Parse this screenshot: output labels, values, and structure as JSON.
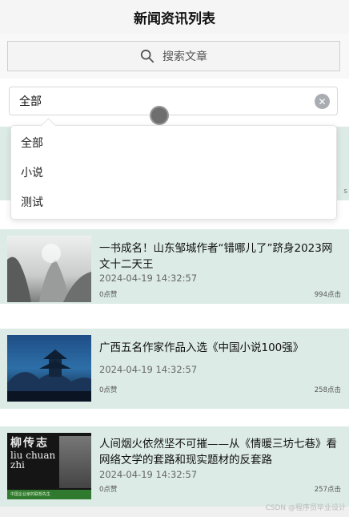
{
  "header": {
    "title": "新闻资讯列表"
  },
  "search": {
    "label": "搜索文章"
  },
  "filter": {
    "selected": "全部",
    "clear_icon": "close-circle-icon",
    "options": [
      "全部",
      "小说",
      "测试"
    ]
  },
  "articles": [
    {
      "title": "一书成名！山东邹城作者“错哪儿了”跻身2023网文十二天王",
      "time": "2024-04-19 14:32:57",
      "likes": "0点赞",
      "clicks": "994点击"
    },
    {
      "title": "广西五名作家作品入选《中国小说100强》",
      "time": "2024-04-19 14:32:57",
      "likes": "0点赞",
      "clicks": "258点击"
    },
    {
      "title": "人间烟火依然坚不可摧——从《情暖三坊七巷》看网络文学的套路和现实题材的反套路",
      "time": "2024-04-19 14:32:57",
      "likes": "0点赞",
      "clicks": "257点击"
    }
  ],
  "thumb3_text": {
    "top": "柳传志",
    "latin": "liu chuan zhi",
    "bottom": "中国企业家的联想先生"
  },
  "partial_row": {
    "edge_text": "s"
  },
  "watermark": "CSDN @程序员毕业设计"
}
